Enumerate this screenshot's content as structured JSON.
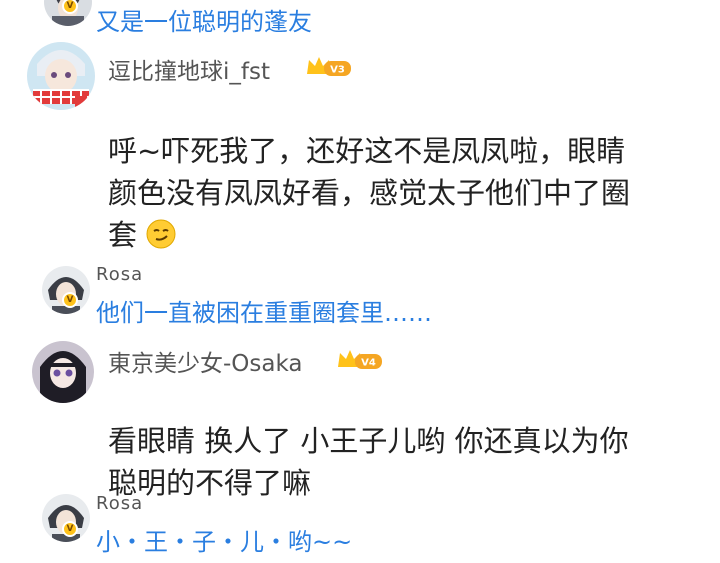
{
  "colors": {
    "link_blue": "#2a7ee0",
    "username_gray": "#555555",
    "body_text": "#222222",
    "vip_gold": "#ffc21a"
  },
  "items": [
    {
      "type": "reply",
      "text": "又是一位聪明的蓬友"
    },
    {
      "type": "comment",
      "username": "逗比撞地球i_fst",
      "level": "V3",
      "lines": [
        "呼~吓死我了，还好这不是凤凤啦，眼睛",
        "颜色没有凤凤好看，感觉太子他们中了圈",
        "套"
      ],
      "emoji": "smirk-emoji"
    },
    {
      "type": "reply",
      "username": "Rosa",
      "text": "他们一直被困在重重圈套里……"
    },
    {
      "type": "comment",
      "username": "東京美少女-Osaka",
      "level": "V4",
      "lines": [
        "看眼睛 换人了 小王子儿哟 你还真以为你",
        "聪明的不得了嘛"
      ]
    },
    {
      "type": "reply",
      "username": "Rosa",
      "text": "小・王・子・儿・哟~~"
    }
  ],
  "vip_badge_letter": "V"
}
